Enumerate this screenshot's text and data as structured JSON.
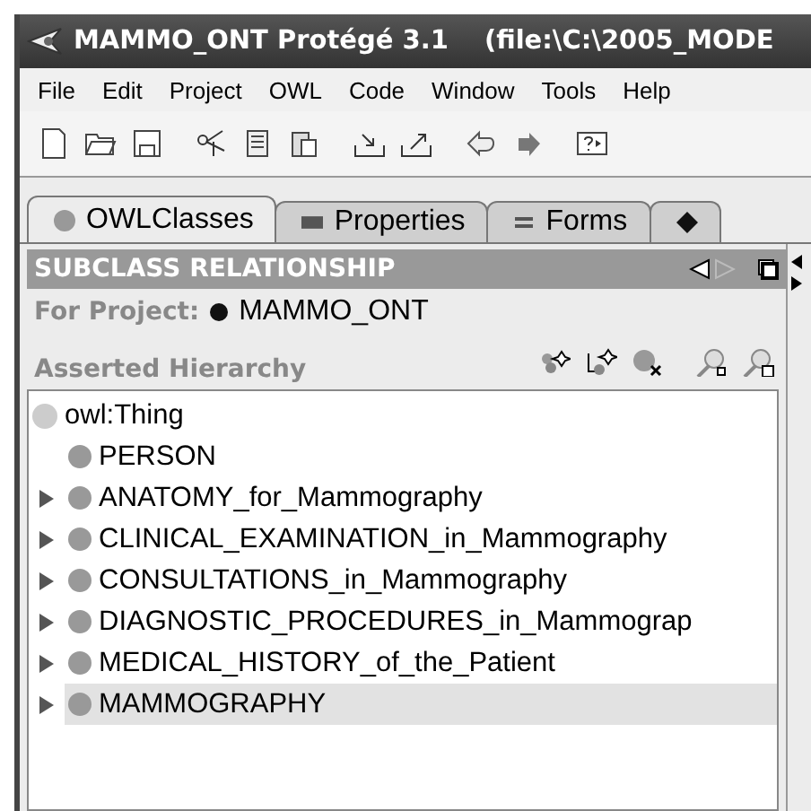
{
  "window": {
    "title": "MAMMO_ONT  Protégé 3.1",
    "path": "(file:\\C:\\2005_MODE"
  },
  "menu": [
    "File",
    "Edit",
    "Project",
    "OWL",
    "Code",
    "Window",
    "Tools",
    "Help"
  ],
  "toolbar": [
    {
      "kind": "new"
    },
    {
      "kind": "open"
    },
    {
      "kind": "save"
    },
    {
      "kind": "cut"
    },
    {
      "kind": "copy"
    },
    {
      "kind": "paste"
    },
    {
      "kind": "import"
    },
    {
      "kind": "export"
    },
    {
      "kind": "undo"
    },
    {
      "kind": "redo"
    },
    {
      "kind": "help"
    }
  ],
  "tabs": [
    {
      "kind": "circle",
      "label": "OWLClasses",
      "selected": true
    },
    {
      "kind": "square",
      "label": "Properties",
      "selected": false
    },
    {
      "kind": "lines",
      "label": "Forms",
      "selected": false
    },
    {
      "kind": "diamond",
      "selected": false
    }
  ],
  "panel": {
    "title": "SUBCLASS RELATIONSHIP",
    "project_label": "For Project:",
    "project": "MAMMO_ONT",
    "hierarchy_label": "Asserted Hierarchy"
  },
  "tree": [
    {
      "label": "owl:Thing",
      "selected": false,
      "expanded": true,
      "children": [
        {
          "label": "PERSON",
          "selected": false,
          "expandable": false
        },
        {
          "label": "ANATOMY_for_Mammography",
          "selected": false,
          "expandable": true
        },
        {
          "label": "CLINICAL_EXAMINATION_in_Mammography",
          "selected": false,
          "expandable": true
        },
        {
          "label": "CONSULTATIONS_in_Mammography",
          "selected": false,
          "expandable": true
        },
        {
          "label": "DIAGNOSTIC_PROCEDURES_in_Mammograp",
          "selected": false,
          "expandable": true
        },
        {
          "label": "MEDICAL_HISTORY_of_the_Patient",
          "selected": false,
          "expandable": true
        },
        {
          "label": "MAMMOGRAPHY",
          "selected": true,
          "expandable": true
        }
      ]
    }
  ]
}
